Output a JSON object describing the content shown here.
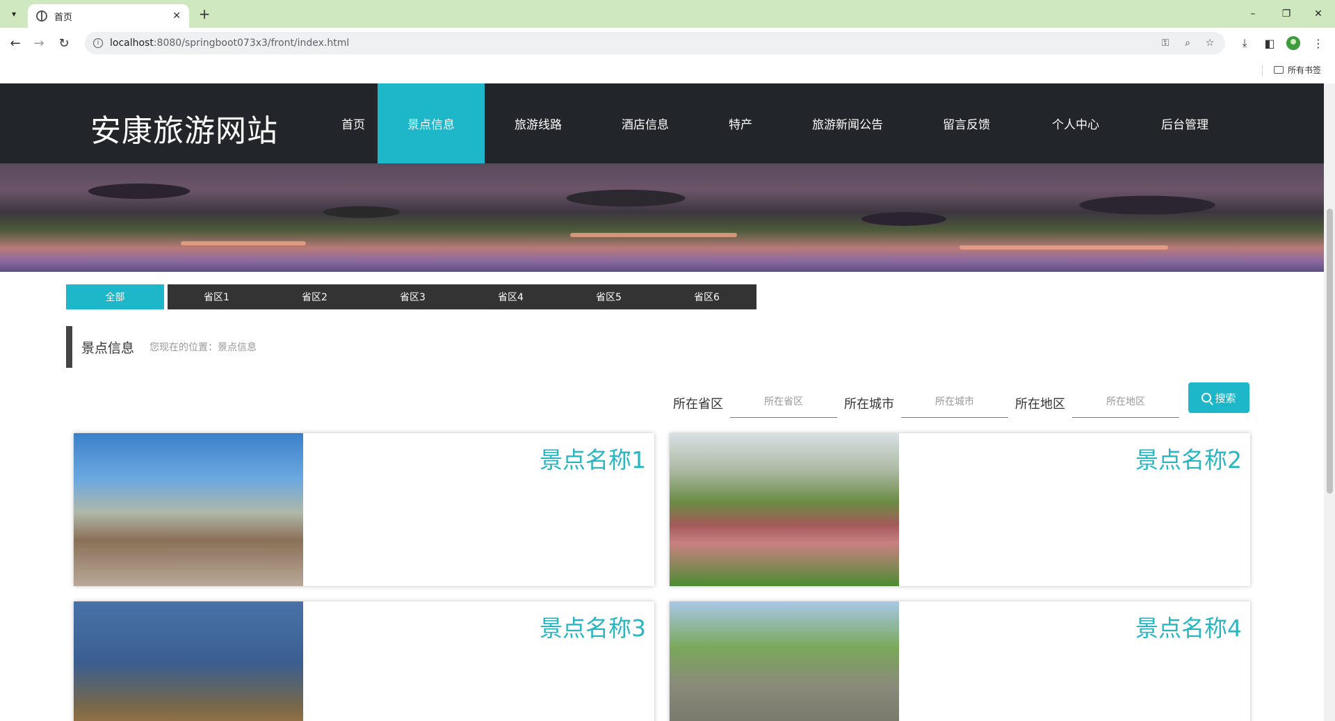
{
  "browser": {
    "tab_title": "首页",
    "url_host": "localhost",
    "url_path": ":8080/springboot073x3/front/index.html",
    "bookmarks_all": "所有书签"
  },
  "site": {
    "logo": "安康旅游网站",
    "nav": [
      {
        "label": "首页",
        "active": false
      },
      {
        "label": "景点信息",
        "active": true
      },
      {
        "label": "旅游线路",
        "active": false
      },
      {
        "label": "酒店信息",
        "active": false
      },
      {
        "label": "特产",
        "active": false
      },
      {
        "label": "旅游新闻公告",
        "active": false
      },
      {
        "label": "留言反馈",
        "active": false
      },
      {
        "label": "个人中心",
        "active": false
      },
      {
        "label": "后台管理",
        "active": false
      }
    ]
  },
  "filters": [
    {
      "label": "全部",
      "active": true
    },
    {
      "label": "省区1",
      "active": false
    },
    {
      "label": "省区2",
      "active": false
    },
    {
      "label": "省区3",
      "active": false
    },
    {
      "label": "省区4",
      "active": false
    },
    {
      "label": "省区5",
      "active": false
    },
    {
      "label": "省区6",
      "active": false
    }
  ],
  "section": {
    "title": "景点信息",
    "location": "您现在的位置：景点信息"
  },
  "search": {
    "province_label": "所在省区",
    "province_placeholder": "所在省区",
    "city_label": "所在城市",
    "city_placeholder": "所在城市",
    "district_label": "所在地区",
    "district_placeholder": "所在地区",
    "button": "搜索"
  },
  "cards": [
    {
      "title": "景点名称1"
    },
    {
      "title": "景点名称2"
    },
    {
      "title": "景点名称3"
    },
    {
      "title": "景点名称4"
    }
  ],
  "colors": {
    "accent": "#1eb6c9",
    "header_bg": "#22252a",
    "card_title": "#27b6c2"
  }
}
